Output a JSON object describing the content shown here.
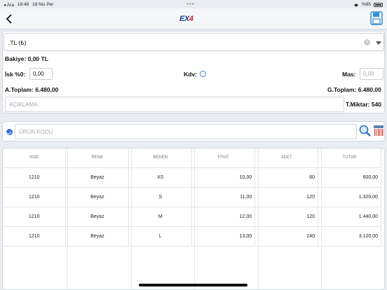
{
  "status_bar": {
    "app": "◂ Ara",
    "time": "18:48",
    "date": "18 Nis Per",
    "battery": "%95"
  },
  "navbar": {
    "logo_ex": "EX",
    "logo_4": "4"
  },
  "form": {
    "currency_value": ".TL (₺)",
    "clear": "×",
    "bakiye": "Bakiye: 0,00 TL",
    "isk_label": "İsk %0:",
    "isk_value": "0,00",
    "kdv_label": "Kdv:",
    "mas_label": "Mas:",
    "mas_placeholder": "0,00",
    "a_toplam": "A.Toplam: 6.480,00",
    "g_toplam": "G.Toplam: 6.480,00",
    "aciklama_placeholder": "AÇIKLAMA:",
    "t_miktar": "T.Miktar: 540"
  },
  "product_search": {
    "placeholder": "ÜRÜN KODU"
  },
  "table": {
    "headers": [
      "KOD",
      "RENK",
      "BEDEN",
      "FİYAT",
      "ADET",
      "TUTAR"
    ],
    "rows": [
      [
        "1210",
        "Beyaz",
        "XS",
        "10,00",
        "60",
        "600,00"
      ],
      [
        "1210",
        "Beyaz",
        "S",
        "11,00",
        "120",
        "1.320,00"
      ],
      [
        "1210",
        "Beyaz",
        "M",
        "12,00",
        "120",
        "1.440,00"
      ],
      [
        "1210",
        "Beyaz",
        "L",
        "13,00",
        "240",
        "3.120,00"
      ]
    ]
  },
  "colors": {
    "accent": "#2f6fd6",
    "logo_blue": "#1a3b8c",
    "logo_red": "#d32027"
  }
}
